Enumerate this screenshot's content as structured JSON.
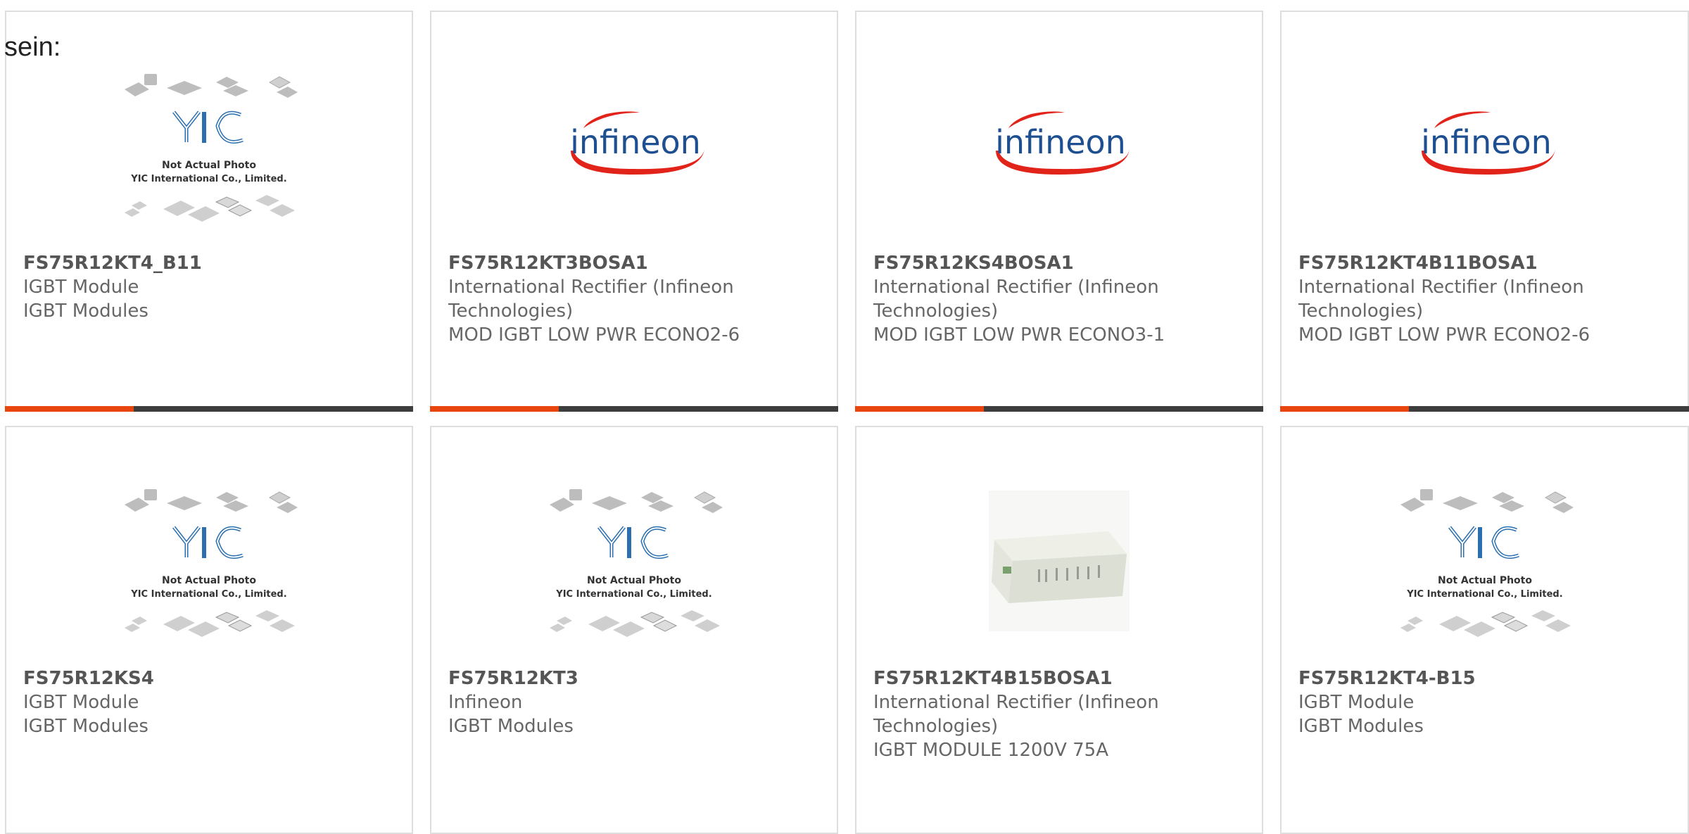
{
  "intro": "sein:",
  "colors": {
    "accent": "#e8440e",
    "bar": "#3d3d3d",
    "border": "#dedede",
    "infineon_red": "#e2231a",
    "infineon_blue": "#1e4f91"
  },
  "placeholder": {
    "logo_text": "YIC",
    "line1": "Not Actual Photo",
    "line2": "YIC International Co., Limited."
  },
  "brand_logo": "infineon",
  "cards": [
    {
      "part": "FS75R12KT4_B11",
      "lines": [
        "IGBT Module",
        "IGBT Modules"
      ],
      "image": "placeholder"
    },
    {
      "part": "FS75R12KT3BOSA1",
      "lines": [
        "International Rectifier (Infineon",
        "Technologies)",
        "MOD IGBT LOW PWR ECONO2-6"
      ],
      "image": "infineon-logo"
    },
    {
      "part": "FS75R12KS4BOSA1",
      "lines": [
        "International Rectifier (Infineon",
        "Technologies)",
        "MOD IGBT LOW PWR ECONO3-1"
      ],
      "image": "infineon-logo"
    },
    {
      "part": "FS75R12KT4B11BOSA1",
      "lines": [
        "International Rectifier (Infineon",
        "Technologies)",
        "MOD IGBT LOW PWR ECONO2-6"
      ],
      "image": "infineon-logo"
    },
    {
      "part": "FS75R12KS4",
      "lines": [
        "IGBT Module",
        "IGBT Modules"
      ],
      "image": "placeholder"
    },
    {
      "part": "FS75R12KT3",
      "lines": [
        "Infineon",
        "IGBT Modules"
      ],
      "image": "placeholder"
    },
    {
      "part": "FS75R12KT4B15BOSA1",
      "lines": [
        "International Rectifier (Infineon",
        "Technologies)",
        "IGBT MODULE 1200V 75A"
      ],
      "image": "module-photo"
    },
    {
      "part": "FS75R12KT4-B15",
      "lines": [
        "IGBT Module",
        "IGBT Modules"
      ],
      "image": "placeholder"
    }
  ]
}
